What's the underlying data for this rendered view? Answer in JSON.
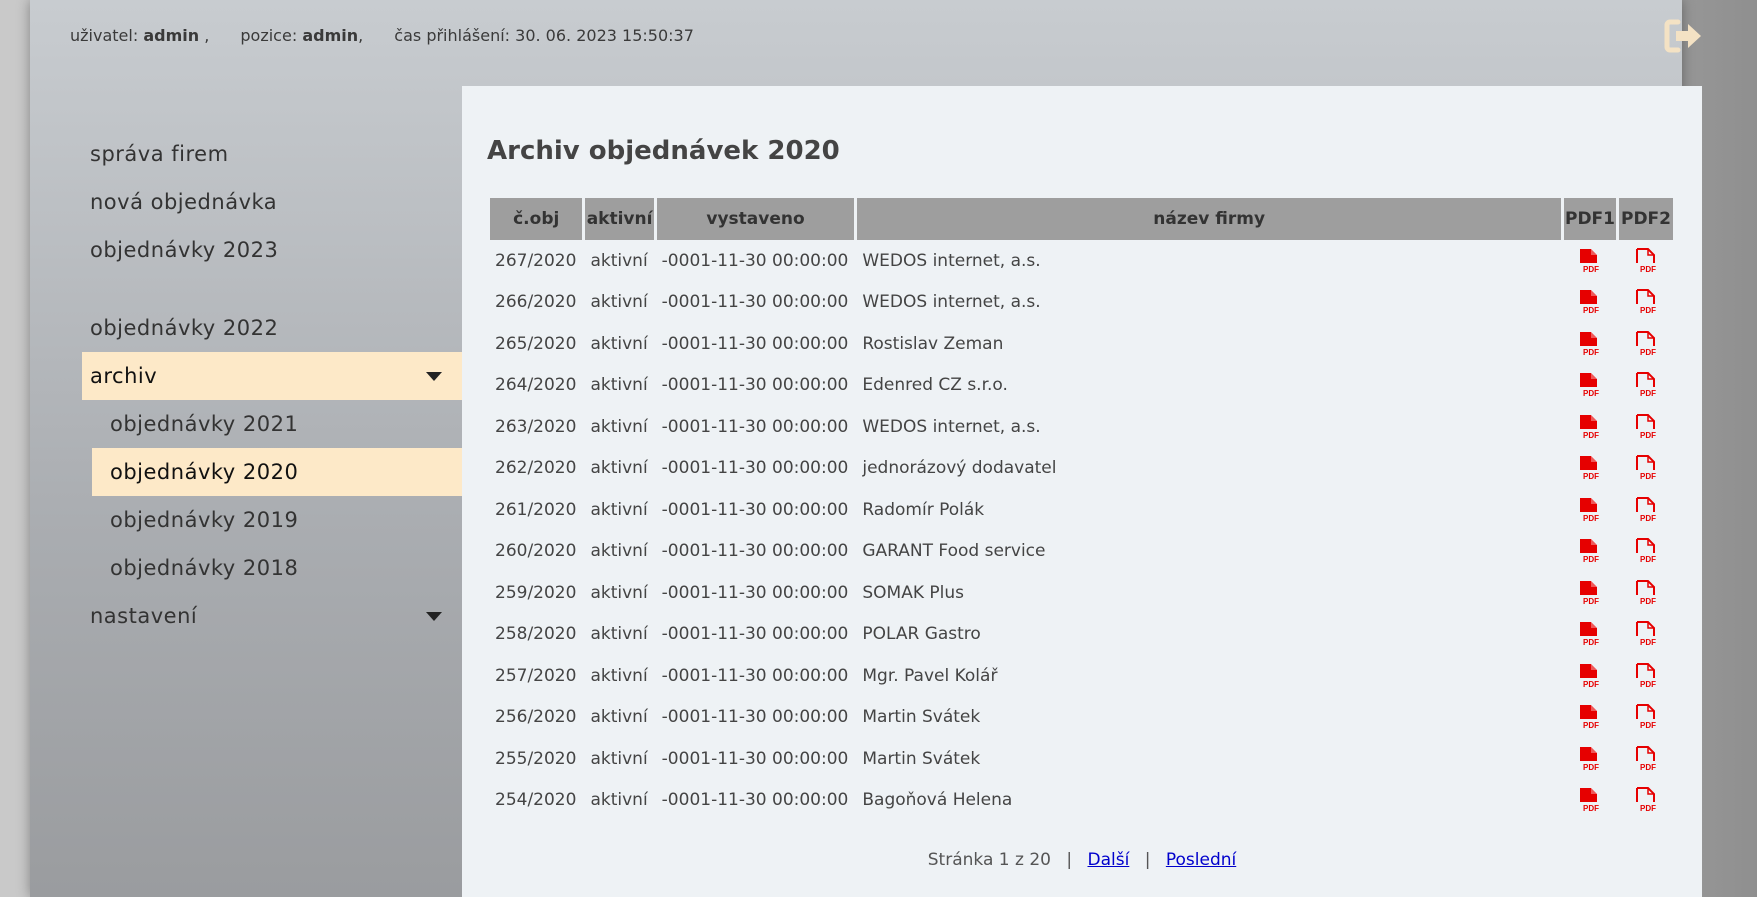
{
  "header": {
    "user_label": "uživatel:",
    "user_value": "admin",
    "user_suffix": ",",
    "position_label": "pozice:",
    "position_value": "admin",
    "position_suffix": ",",
    "login_time_label": "čas přihlášení:",
    "login_time_value": "30. 06. 2023 15:50:37",
    "logout_icon": "logout-icon"
  },
  "sidebar": {
    "items": [
      {
        "label": "správa firem"
      },
      {
        "label": "nová objednávka"
      },
      {
        "label": "objednávky 2023"
      },
      {
        "label": "objednávky 2022"
      },
      {
        "label": "archiv"
      },
      {
        "label": "objednávky 2021"
      },
      {
        "label": "objednávky 2020"
      },
      {
        "label": "objednávky 2019"
      },
      {
        "label": "objednávky 2018"
      },
      {
        "label": "nastavení"
      }
    ]
  },
  "main": {
    "title": "Archiv objednávek 2020",
    "columns": [
      "č.obj",
      "aktivní",
      "vystaveno",
      "název firmy",
      "PDF1",
      "PDF2"
    ],
    "rows": [
      [
        "267/2020",
        "aktivní",
        "-0001-11-30 00:00:00",
        "WEDOS internet, a.s."
      ],
      [
        "266/2020",
        "aktivní",
        "-0001-11-30 00:00:00",
        "WEDOS internet, a.s."
      ],
      [
        "265/2020",
        "aktivní",
        "-0001-11-30 00:00:00",
        "Rostislav Zeman"
      ],
      [
        "264/2020",
        "aktivní",
        "-0001-11-30 00:00:00",
        "Edenred CZ s.r.o."
      ],
      [
        "263/2020",
        "aktivní",
        "-0001-11-30 00:00:00",
        "WEDOS internet, a.s."
      ],
      [
        "262/2020",
        "aktivní",
        "-0001-11-30 00:00:00",
        "jednorázový dodavatel"
      ],
      [
        "261/2020",
        "aktivní",
        "-0001-11-30 00:00:00",
        "Radomír Polák"
      ],
      [
        "260/2020",
        "aktivní",
        "-0001-11-30 00:00:00",
        "GARANT Food service"
      ],
      [
        "259/2020",
        "aktivní",
        "-0001-11-30 00:00:00",
        "SOMAK Plus"
      ],
      [
        "258/2020",
        "aktivní",
        "-0001-11-30 00:00:00",
        "POLAR Gastro"
      ],
      [
        "257/2020",
        "aktivní",
        "-0001-11-30 00:00:00",
        "Mgr. Pavel Kolář"
      ],
      [
        "256/2020",
        "aktivní",
        "-0001-11-30 00:00:00",
        "Martin Svátek"
      ],
      [
        "255/2020",
        "aktivní",
        "-0001-11-30 00:00:00",
        "Martin Svátek"
      ],
      [
        "254/2020",
        "aktivní",
        "-0001-11-30 00:00:00",
        "Bagoňová Helena"
      ]
    ],
    "pdf_icon_text": "PDF"
  },
  "pager": {
    "status": "Stránka 1 z 20",
    "separator": "|",
    "next_label": "Další",
    "last_label": "Poslední"
  },
  "colors": {
    "active_nav_bg": "#fde9c8",
    "table_header_bg": "#9e9e9e",
    "pdf_red": "#e60000",
    "logout_icon": "#f4e2c4",
    "link": "#0000cc"
  }
}
